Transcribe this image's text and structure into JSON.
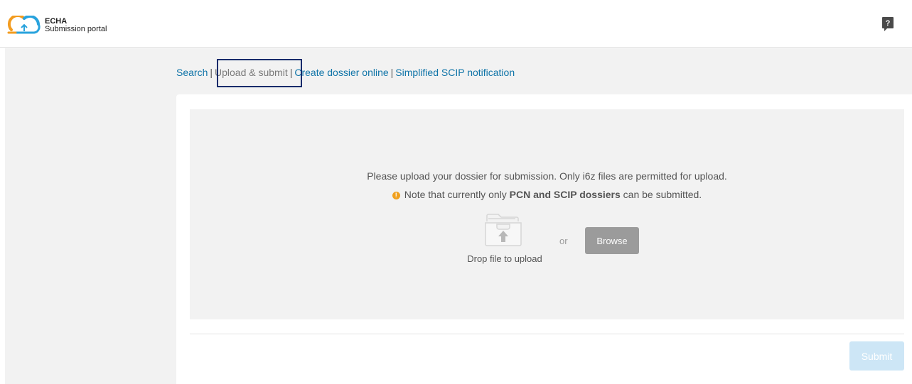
{
  "header": {
    "brand_line1": "ECHA",
    "brand_line2": "Submission portal",
    "help_icon": "help-icon"
  },
  "nav": {
    "items": [
      {
        "label": "Search",
        "current": false
      },
      {
        "label": "Upload & submit",
        "current": true
      },
      {
        "label": "Create dossier online",
        "current": false
      },
      {
        "label": "Simplified SCIP notification",
        "current": false
      }
    ],
    "separator": "|"
  },
  "upload": {
    "message": "Please upload your dossier for submission. Only i6z files are permitted for upload.",
    "note_prefix": "Note that currently only ",
    "note_bold": "PCN and SCIP dossiers",
    "note_suffix": " can be submitted.",
    "drop_label": "Drop file to upload",
    "or_label": "or",
    "browse_label": "Browse"
  },
  "footer": {
    "submit_label": "Submit"
  },
  "colors": {
    "link": "#0f74a8",
    "warning": "#f0a01e",
    "browse_bg": "#9b9b9b",
    "submit_disabled_bg": "#cde6f6",
    "highlight_box": "#0c2b6b"
  }
}
